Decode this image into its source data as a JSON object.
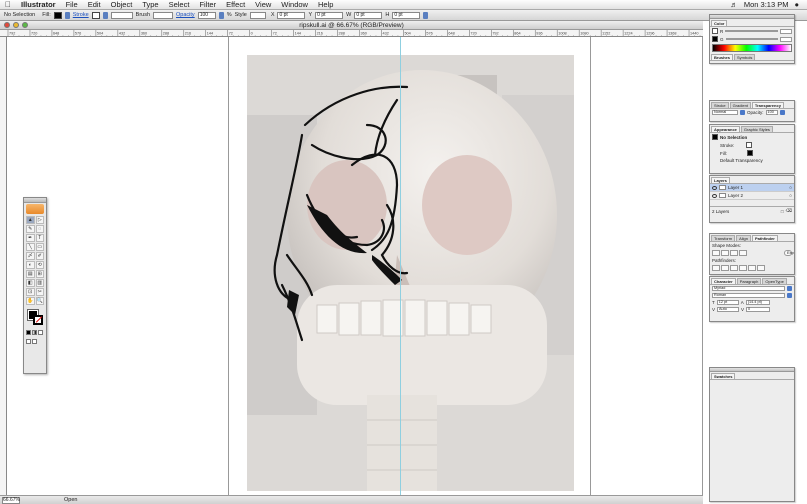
{
  "menubar": {
    "app": "Illustrator",
    "items": [
      "File",
      "Edit",
      "Object",
      "Type",
      "Select",
      "Filter",
      "Effect",
      "View",
      "Window",
      "Help"
    ],
    "clock": "Mon 3:13 PM"
  },
  "control": {
    "selection": "No Selection",
    "fill_label": "Fill:",
    "stroke_label": "Stroke",
    "brush_label": "Brush",
    "opacity_label": "Opacity",
    "opacity_value": "100",
    "percent": "%",
    "style_label": "Style",
    "x_label": "X",
    "y_label": "Y",
    "x_value": "0 pt",
    "y_value": "0 pt",
    "w_label": "W",
    "h_label": "H",
    "w_value": "0 pt",
    "h_value": "0 pt"
  },
  "document": {
    "title": "ripskull.ai @ 66.67% (RGB/Preview)",
    "ruler_ticks": [
      "792",
      "720",
      "648",
      "576",
      "504",
      "432",
      "360",
      "288",
      "216",
      "144",
      "72",
      "0",
      "72",
      "144",
      "216",
      "288",
      "360",
      "432",
      "504",
      "576",
      "648",
      "720",
      "792",
      "864",
      "936",
      "1008",
      "1080",
      "1152",
      "1224",
      "1296",
      "1368",
      "1440"
    ],
    "zoom": "66.67%",
    "status": "Open"
  },
  "tools": {
    "items": [
      "▲",
      "▷",
      "✎",
      "◌",
      "✒",
      "T",
      "╲",
      "▭",
      "〆",
      "✐",
      "◐",
      "⟲",
      "▤",
      "⊞",
      "◧",
      "▥",
      "⊡",
      "✂",
      "✋",
      "🔍"
    ]
  },
  "color_palette": {
    "tab": "Color",
    "r": "R",
    "g": "G",
    "b": "B",
    "tabs2": [
      "Brushes",
      "Symbols"
    ]
  },
  "stroke_palette": {
    "tabs": [
      "Stroke",
      "Gradient",
      "Transparency"
    ],
    "mode": "Normal",
    "opacity_label": "Opacity:",
    "opacity_value": "100"
  },
  "appearance": {
    "tabs": [
      "Appearance",
      "Graphic Styles"
    ],
    "selection": "No Selection",
    "stroke_label": "Stroke:",
    "fill_label": "Fill:",
    "default_transparency": "Default Transparency"
  },
  "layers": {
    "tab": "Layers",
    "items": [
      "Layer 1",
      "Layer 2"
    ],
    "footer": "2 Layers"
  },
  "pathfinder": {
    "tabs": [
      "Transform",
      "Align",
      "Pathfinder"
    ],
    "shape_modes": "Shape Modes:",
    "expand": "Expand",
    "pathfinders": "Pathfinders:"
  },
  "character": {
    "tabs": [
      "Character",
      "Paragraph",
      "OpenType"
    ],
    "font": "Myriad",
    "style": "Roman",
    "size": "12 pt",
    "leading": "(14.4 pt)",
    "kerning": "Auto",
    "tracking": "0"
  },
  "swatches": {
    "tab": "Swatches"
  }
}
